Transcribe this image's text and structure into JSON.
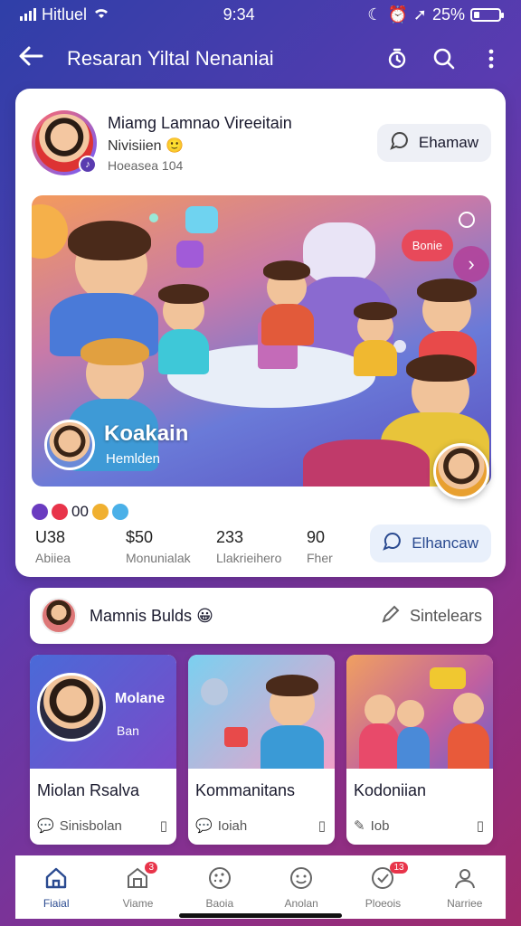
{
  "status_bar": {
    "carrier": "Hitluel",
    "time": "9:34",
    "battery": "25%",
    "battery_level": 0.25
  },
  "app_bar": {
    "title": "Resaran Yiltal Nenaniai"
  },
  "post": {
    "author": "Miamg Lamnao Vireeitain",
    "subtitle": "Nivisiien",
    "meta": "Hoeasea 104",
    "follow_label": "Ehamaw",
    "hero": {
      "title": "Koakain",
      "subtitle": "Hemlden",
      "bubble_label": "Bonie"
    },
    "reactions_count": "00",
    "stats": [
      {
        "value": "U38",
        "label": "Abiiea"
      },
      {
        "value": "$50",
        "label": "Monunialak"
      },
      {
        "value": "233",
        "label": "Llakrieihero"
      },
      {
        "value": "90",
        "label": "Fher"
      }
    ],
    "message_label": "Elhancaw"
  },
  "friends": {
    "title": "Mamnis Bulds",
    "action_label": "Sintelears"
  },
  "tiles": [
    {
      "title": "Miolan Rsalva",
      "foot": "Sinisbolan",
      "badge": "Molane",
      "badge_sub": "Ban"
    },
    {
      "title": "Kommanitans",
      "foot": "Ioiah"
    },
    {
      "title": "Kodoniian",
      "foot": "Iob"
    }
  ],
  "bottom_nav": [
    {
      "label": "Fiaial",
      "icon": "home-icon",
      "active": true
    },
    {
      "label": "Viame",
      "icon": "store-icon",
      "badge": "3"
    },
    {
      "label": "Baoia",
      "icon": "cookie-icon"
    },
    {
      "label": "Anolan",
      "icon": "smile-icon"
    },
    {
      "label": "Ploeois",
      "icon": "check-icon",
      "badge": "13"
    },
    {
      "label": "Narriee",
      "icon": "person-icon"
    }
  ]
}
